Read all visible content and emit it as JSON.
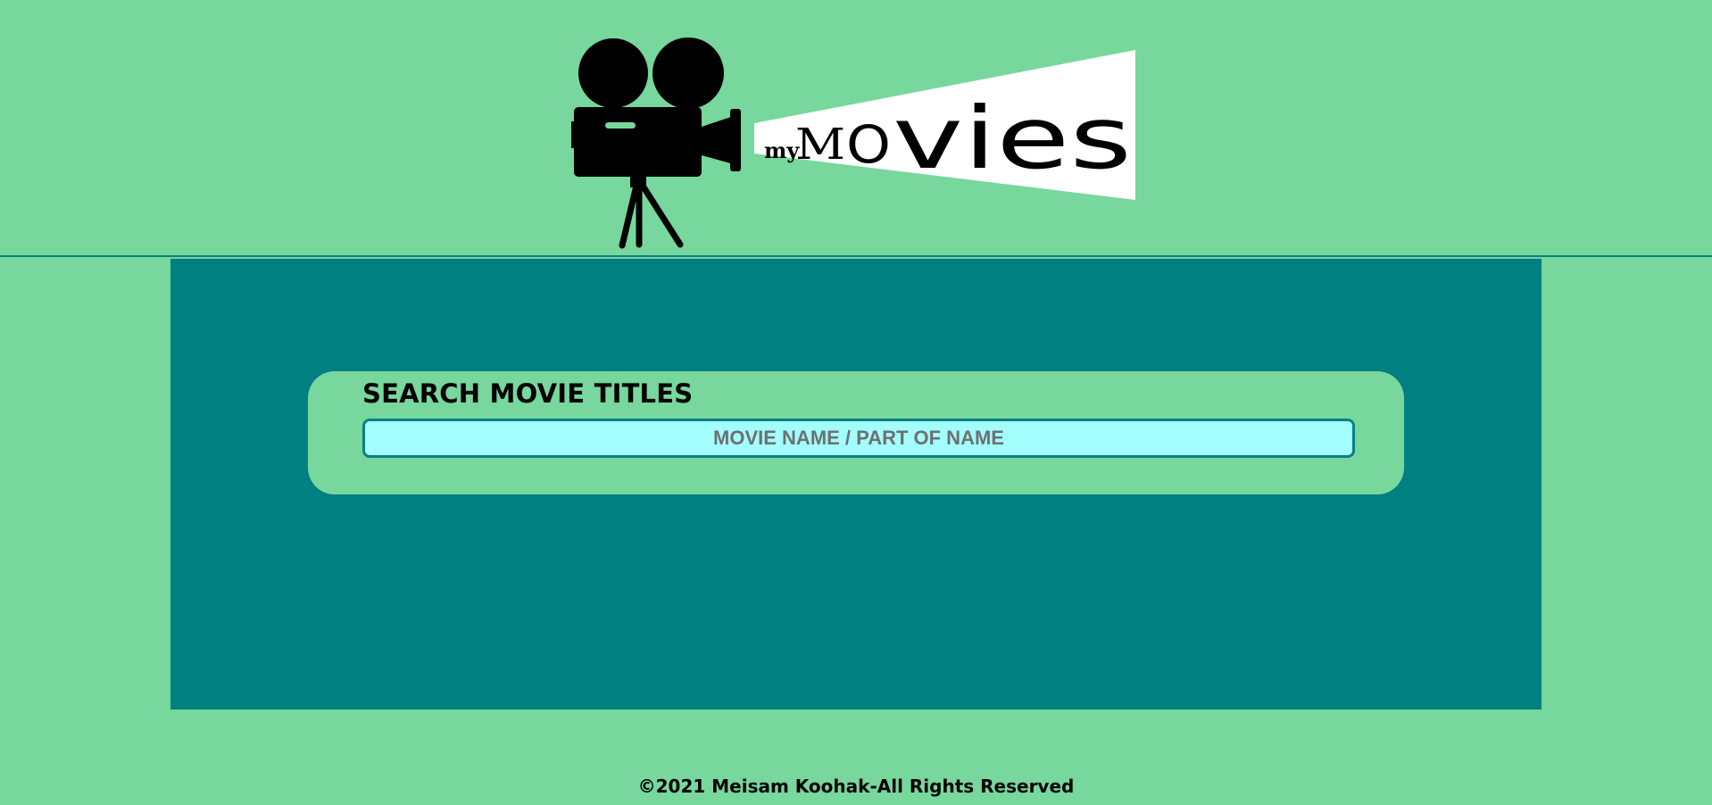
{
  "header": {
    "logo": {
      "icon": "movie-camera-icon",
      "wordmark": "myMOvies"
    }
  },
  "search": {
    "title": "SEARCH MOVIE TITLES",
    "value": "",
    "placeholder": "MOVIE NAME / PART OF NAME"
  },
  "footer": {
    "copyright": "©2021 Meisam Koohak-All Rights Reserved"
  },
  "colors": {
    "background": "#77d79d",
    "panel": "#008080",
    "input_background": "#a2fffe",
    "input_border": "#0b7f81",
    "accent_line": "#0a7f80"
  }
}
